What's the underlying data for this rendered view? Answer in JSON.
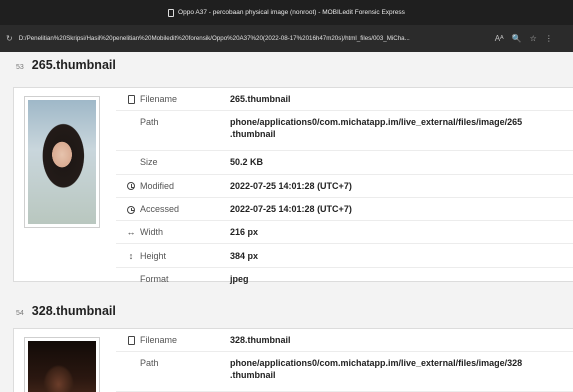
{
  "window": {
    "title": "Oppo A37 - percobaan physical image (nonroot) - MOBILedit Forensic Express"
  },
  "browser": {
    "url": "D:/Penelitian%20Skripsi/Hasil%20penelitian%20Mobiledit%20forensik/Oppo%20A37%20(2022-08-17%2016h47m20s)/html_files/003_MiCha...",
    "reload_glyph": "↻",
    "tools": [
      "Aᴬ",
      "🔍",
      "☆",
      "⋮"
    ]
  },
  "items": [
    {
      "index": "53",
      "name": "265.thumbnail",
      "rows": [
        {
          "icon": "file-icon",
          "label": "Filename",
          "value": "265.thumbnail"
        },
        {
          "icon": "",
          "label": "Path",
          "value": "phone/applications0/com.michatapp.im/live_external/files/image/265",
          "value2": ".thumbnail"
        },
        {
          "icon": "",
          "label": "Size",
          "value": "50.2 KB"
        },
        {
          "icon": "clock-icon",
          "label": "Modified",
          "value": "2022-07-25 14:01:28 (UTC+7)"
        },
        {
          "icon": "clock-icon",
          "label": "Accessed",
          "value": "2022-07-25 14:01:28 (UTC+7)"
        },
        {
          "icon": "width-arrow-icon",
          "glyph": "↔",
          "label": "Width",
          "value": "216 px"
        },
        {
          "icon": "height-arrow-icon",
          "glyph": "↕",
          "label": "Height",
          "value": "384 px"
        },
        {
          "icon": "",
          "label": "Format",
          "value": "jpeg"
        }
      ]
    },
    {
      "index": "54",
      "name": "328.thumbnail",
      "rows": [
        {
          "icon": "file-icon",
          "label": "Filename",
          "value": "328.thumbnail"
        },
        {
          "icon": "",
          "label": "Path",
          "value": "phone/applications0/com.michatapp.im/live_external/files/image/328",
          "value2": ".thumbnail"
        }
      ]
    }
  ]
}
